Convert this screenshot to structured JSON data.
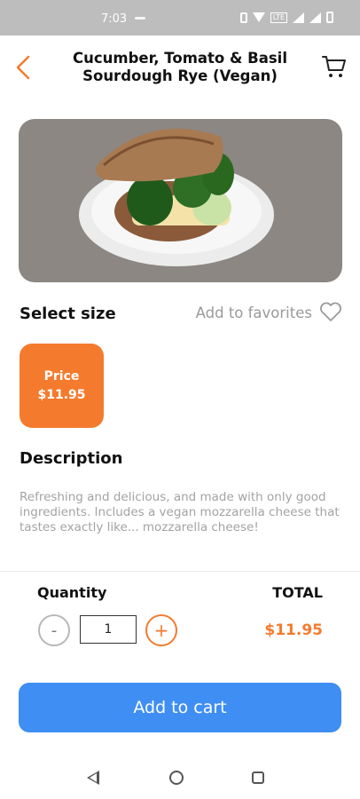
{
  "status_bar": {
    "time": "7:03",
    "network": "LTE"
  },
  "header": {
    "title_line1": "Cucumber, Tomato & Basil",
    "title_line2": "Sourdough Rye (Vegan)"
  },
  "product": {
    "image": "sandwich-photo",
    "select_size_label": "Select size",
    "favorite_label": "Add to favorites",
    "size_option": {
      "label": "Price",
      "price": "$11.95"
    },
    "description_heading": "Description",
    "description": "Refreshing and delicious, and made with only good ingredients. Includes a vegan mozzarella cheese that tastes exactly like... mozzarella cheese!"
  },
  "order": {
    "quantity_label": "Quantity",
    "quantity_value": "1",
    "minus_symbol": "-",
    "plus_symbol": "+",
    "total_label": "TOTAL",
    "total_value": "$11.95",
    "add_to_cart_label": "Add to cart"
  },
  "colors": {
    "accent": "#f47b2e",
    "primary_button": "#3f8ef3",
    "image_bg": "#8c8783"
  },
  "icons": [
    "back-chevron-icon",
    "cart-icon",
    "heart-icon",
    "nav-back-icon",
    "nav-home-icon",
    "nav-recent-icon"
  ]
}
